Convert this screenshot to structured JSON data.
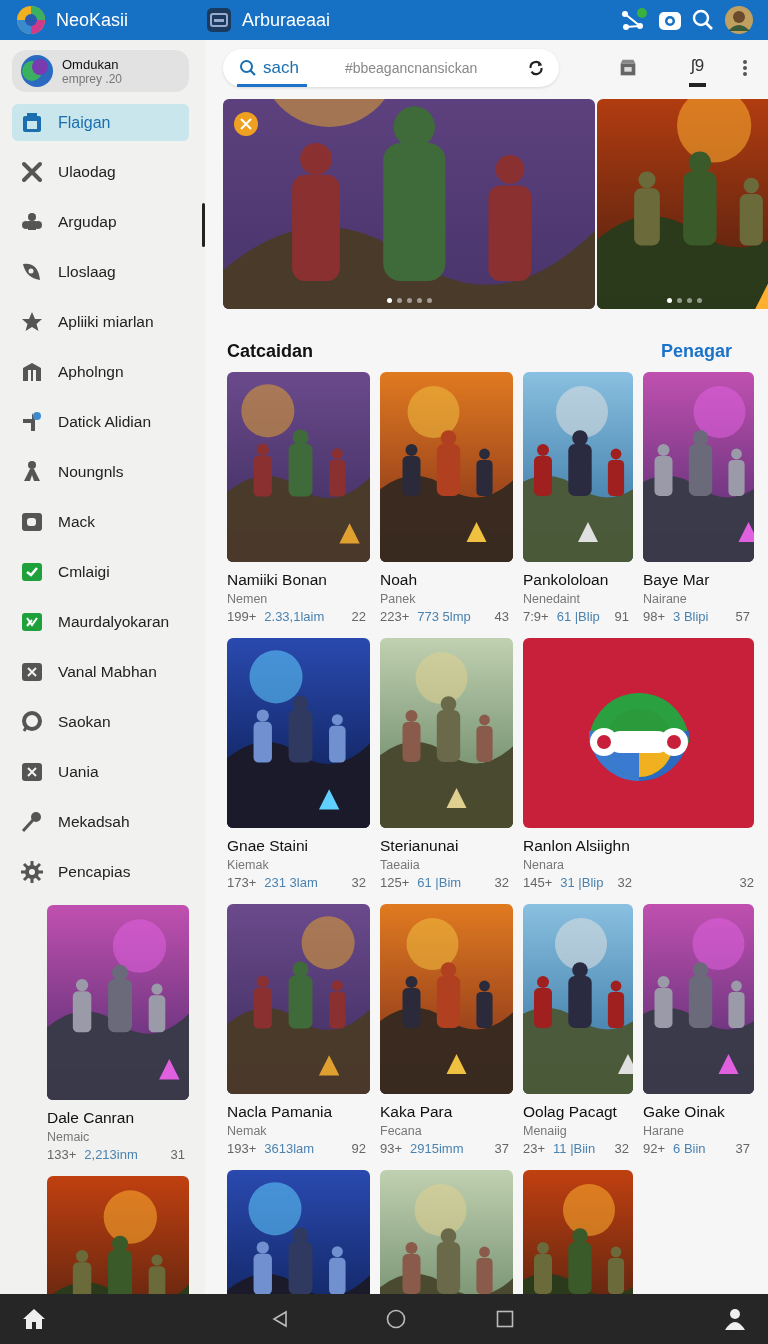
{
  "app_bar": {
    "title": "NeoKasii",
    "subtitle": "Arburaeaai"
  },
  "profile": {
    "name": "Omdukan",
    "subtitle": "emprey .20"
  },
  "sidebar": {
    "items": [
      {
        "label": "Flaigan",
        "selected": true
      },
      {
        "label": "Ulaodag",
        "selected": false
      },
      {
        "label": "Argudap",
        "selected": false
      },
      {
        "label": "Lloslaag",
        "selected": false
      },
      {
        "label": "Apliiki miarlan",
        "selected": false
      },
      {
        "label": "Apholngn",
        "selected": false
      },
      {
        "label": "Datick Alidian",
        "selected": false
      },
      {
        "label": "Noungnls",
        "selected": false
      },
      {
        "label": "Mack",
        "selected": false
      },
      {
        "label": "Cmlaigi",
        "selected": false
      },
      {
        "label": "Maurdalyokaran",
        "selected": false
      },
      {
        "label": "Vanal Mabhan",
        "selected": false
      },
      {
        "label": "Saokan",
        "selected": false
      },
      {
        "label": "Uania",
        "selected": false
      },
      {
        "label": "Mekadsah",
        "selected": false
      },
      {
        "label": "Pencapias",
        "selected": false
      }
    ]
  },
  "sidebar_cards": [
    {
      "kind": "cover",
      "title": "Dale Canran",
      "publisher": "Nemaic",
      "rating": "133+",
      "size": "2,213inm",
      "count": "31"
    },
    {
      "kind": "cover"
    }
  ],
  "search": {
    "tab": "sach",
    "placeholder": "#bbeagancnansickan"
  },
  "toolbar_tab": {
    "label": "ʃ9",
    "selected": true
  },
  "banners": [
    {
      "dots": [
        {
          "selected": true
        },
        {
          "selected": false
        },
        {
          "selected": false
        },
        {
          "selected": false
        },
        {
          "selected": false
        }
      ]
    },
    {
      "dots": [
        {
          "selected": true
        },
        {
          "selected": false
        },
        {
          "selected": false
        },
        {
          "selected": false
        }
      ]
    }
  ],
  "section": {
    "title": "Catcaidan",
    "link": "Penagar"
  },
  "grid": {
    "rows": [
      [
        {
          "kind": "cover",
          "title": "Namiiki Bonan",
          "publisher": "Nemen",
          "rating": "199+",
          "size": "2.33,1laim",
          "count": "22"
        },
        {
          "kind": "cover",
          "title": "Noah",
          "publisher": "Panek",
          "rating": "223+",
          "size": "773 5lmp",
          "count": "43"
        },
        {
          "kind": "cover",
          "title": "Pankololoan",
          "publisher": "Nenedaint",
          "rating": "7:9+",
          "size": "61 |Blip",
          "count": "91"
        },
        {
          "kind": "cover",
          "title": "Baye Mar",
          "publisher": "Nairane",
          "rating": "98+",
          "size": "3 Blipi",
          "count": "57"
        }
      ],
      [
        {
          "kind": "cover",
          "title": "Gnae Staini",
          "publisher": "Kiemak",
          "rating": "173+",
          "size": "231 3lam",
          "count": "32"
        },
        {
          "kind": "cover",
          "title": "Sterianunai",
          "publisher": "Taeaiia",
          "rating": "125+",
          "size": "61 |Bim",
          "count": "32"
        },
        {
          "kind": "feature",
          "title": "Ranlon Alsiighn",
          "publisher": "Nenara",
          "rating": "145+",
          "size": "31 |Blip",
          "count": "32",
          "extra_count": "32"
        }
      ],
      [
        {
          "kind": "cover",
          "title": "Nacla Pamania",
          "publisher": "Nemak",
          "rating": "193+",
          "size": "3613lam",
          "count": "92"
        },
        {
          "kind": "cover",
          "title": "Kaka Para",
          "publisher": "Fecana",
          "rating": "93+",
          "size": "2915imm",
          "count": "37"
        },
        {
          "kind": "cover",
          "title": "Oolag Pacagt",
          "publisher": "Menaiig",
          "rating": "23+",
          "size": "11 |Biin",
          "count": "32"
        },
        {
          "kind": "cover",
          "title": "Gake Oinak",
          "publisher": "Harane",
          "rating": "92+",
          "size": "6 Biin",
          "count": "37"
        }
      ],
      [
        {
          "kind": "cover"
        },
        {
          "kind": "cover"
        },
        {
          "kind": "cover"
        }
      ]
    ]
  }
}
